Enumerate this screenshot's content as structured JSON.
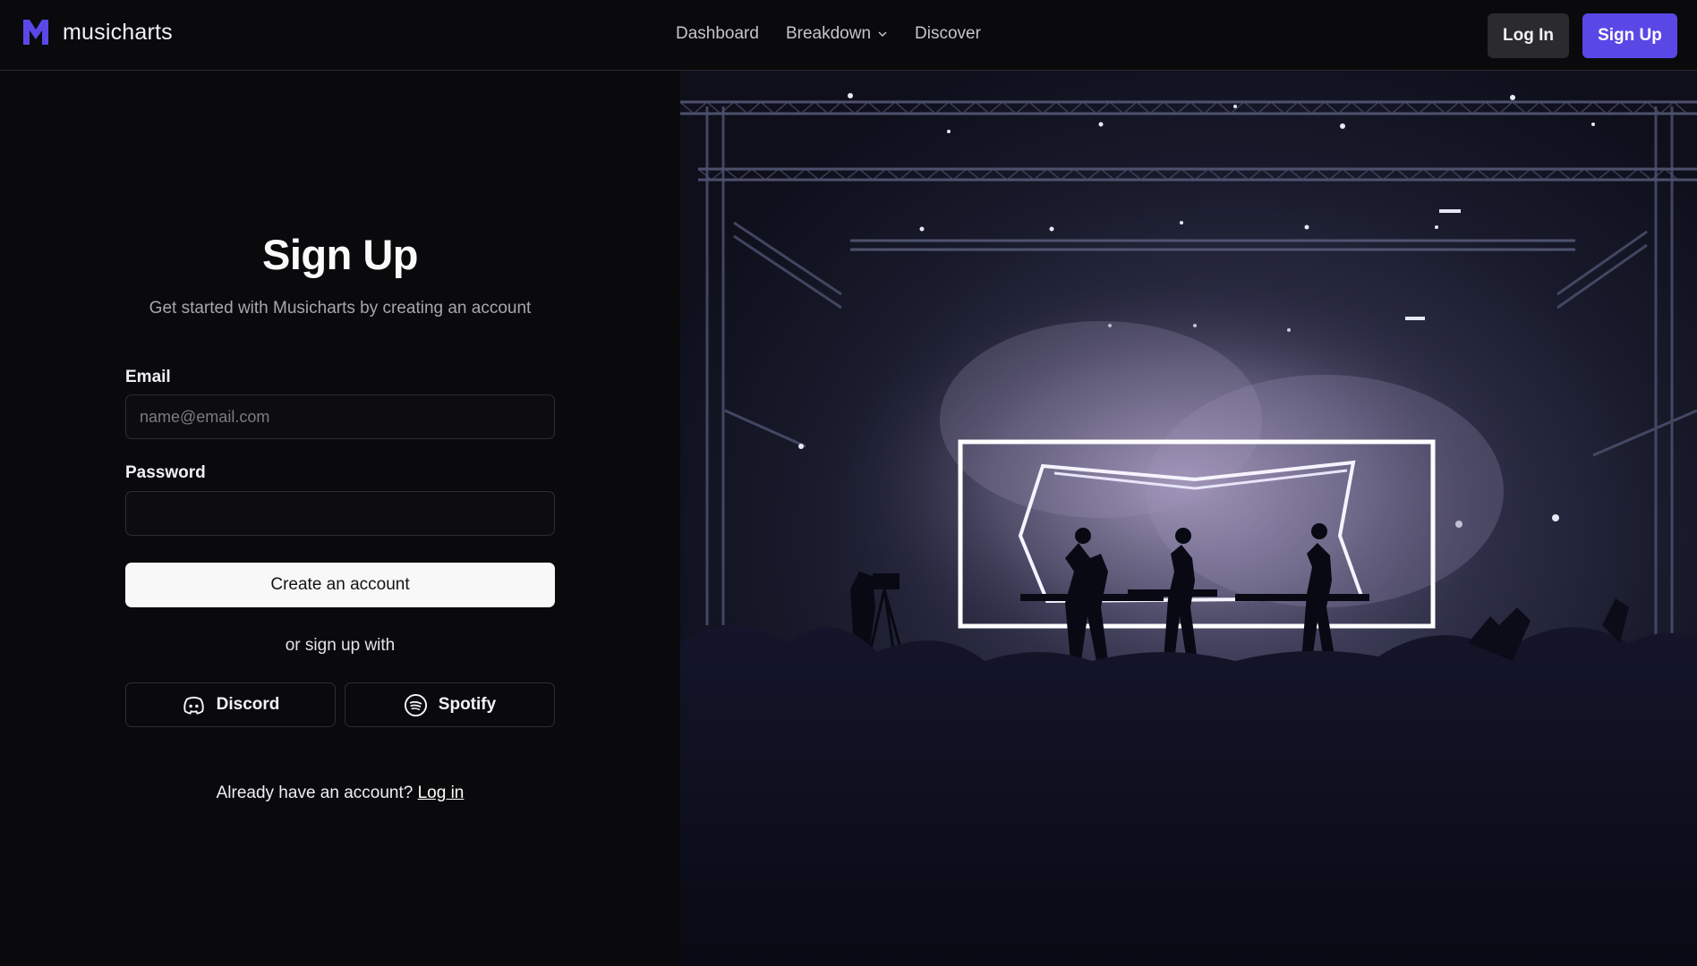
{
  "brand": {
    "name": "musicharts",
    "logo_icon": "m-logo-icon",
    "accent": "#5a48e6"
  },
  "nav": {
    "links": [
      "Dashboard",
      "Breakdown",
      "Discover"
    ],
    "login_label": "Log In",
    "signup_label": "Sign Up"
  },
  "form": {
    "title": "Sign Up",
    "subtitle": "Get started with Musicharts by creating an account",
    "email_label": "Email",
    "email_placeholder": "name@email.com",
    "email_value": "",
    "password_label": "Password",
    "password_value": "",
    "create_label": "Create an account",
    "or_text": "or sign up with",
    "discord_label": "Discord",
    "spotify_label": "Spotify",
    "already_text": "Already have an account?",
    "login_link": "Log in"
  },
  "hero": {
    "description_icon": "concert-stage-image"
  }
}
